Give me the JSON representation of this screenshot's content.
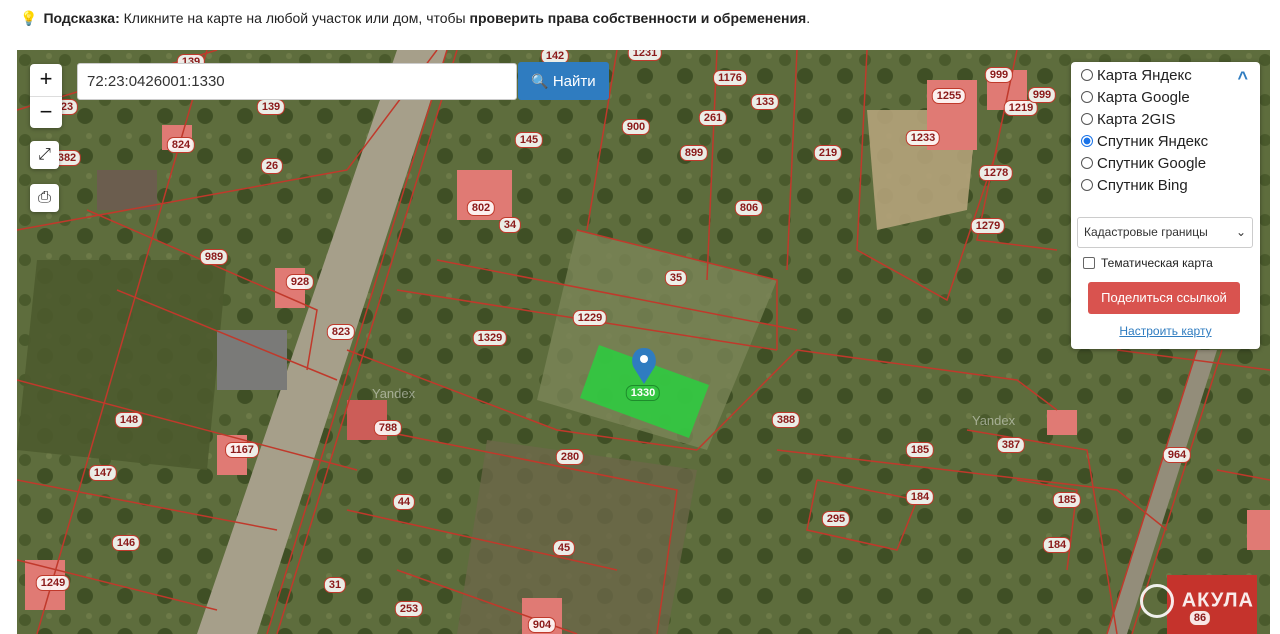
{
  "hint": {
    "label": "Подсказка:",
    "text": " Кликните на карте на любой участок или дом, чтобы ",
    "bold": "проверить права собственности и обременения",
    "end": "."
  },
  "search": {
    "value": "72:23:0426001:1330",
    "button": "Найти"
  },
  "zoom": {
    "in": "+",
    "out": "−"
  },
  "layers": {
    "items": [
      {
        "label": "Карта Яндекс",
        "selected": false
      },
      {
        "label": "Карта Google",
        "selected": false
      },
      {
        "label": "Карта 2GIS",
        "selected": false
      },
      {
        "label": "Спутник Яндекс",
        "selected": true
      },
      {
        "label": "Спутник Google",
        "selected": false
      },
      {
        "label": "Спутник Bing",
        "selected": false
      }
    ],
    "select": "Кадастровые границы",
    "thematic": "Тематическая карта",
    "share": "Поделиться ссылкой",
    "configure": "Настроить карту"
  },
  "selected_plot": "1330",
  "watermark": "АКУЛА",
  "yandex_mark": "Yandex",
  "plot_labels": [
    "139",
    "142",
    "1231",
    "1176",
    "133",
    "999",
    "1219",
    "999",
    "23",
    "824",
    "382",
    "145",
    "900",
    "261",
    "899",
    "219",
    "1255",
    "1233",
    "26",
    "802",
    "34",
    "806",
    "1278",
    "1279",
    "989",
    "928",
    "35",
    "823",
    "1329",
    "1229",
    "148",
    "1167",
    "788",
    "280",
    "388",
    "387",
    "185",
    "964",
    "147",
    "44",
    "184",
    "185",
    "295",
    "146",
    "45",
    "184",
    "1249",
    "31",
    "253",
    "904",
    "86"
  ],
  "colors": {
    "boundary": "#c0392b",
    "selected": "#2ecc40",
    "accent": "#2f7cc0",
    "share": "#d9534f"
  }
}
